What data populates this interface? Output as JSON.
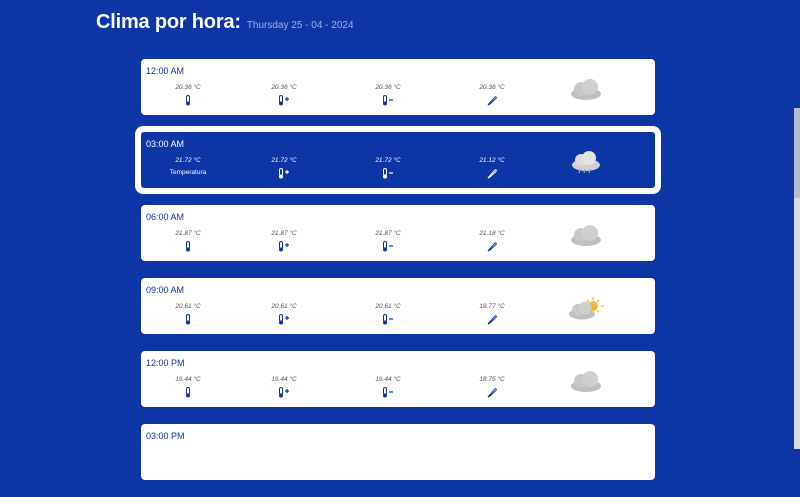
{
  "header": {
    "title": "Clima por hora:",
    "date": "Thursday 25 - 04 - 2024"
  },
  "icons": {
    "temperature": "thermometer-icon",
    "max": "thermometer-plus-icon",
    "min": "thermometer-minus-icon",
    "feels_like": "feather-icon"
  },
  "colors": {
    "background": "#0e35a6",
    "card": "#ffffff",
    "sun": "#f5b731"
  },
  "hours": [
    {
      "time": "12:00 AM",
      "values": [
        "20.36 °C",
        "20.36 °C",
        "20.36 °C",
        "20.36 °C"
      ],
      "weather": "cloudy-icon"
    },
    {
      "time": "03:00 AM",
      "values": [
        "21.72 °C",
        "21.72 °C",
        "21.72 °C",
        "21.12 °C"
      ],
      "label": "Temperatura",
      "weather": "rain-cloud-icon",
      "selected": true
    },
    {
      "time": "06:00 AM",
      "values": [
        "21.87 °C",
        "21.87 °C",
        "21.87 °C",
        "21.18 °C"
      ],
      "weather": "cloudy-icon"
    },
    {
      "time": "09:00 AM",
      "values": [
        "20.61 °C",
        "20.61 °C",
        "20.61 °C",
        "19.77 °C"
      ],
      "weather": "partly-cloudy-icon"
    },
    {
      "time": "12:00 PM",
      "values": [
        "19.44 °C",
        "19.44 °C",
        "19.44 °C",
        "18.75 °C"
      ],
      "weather": "cloudy-icon"
    },
    {
      "time": "03:00 PM"
    }
  ]
}
